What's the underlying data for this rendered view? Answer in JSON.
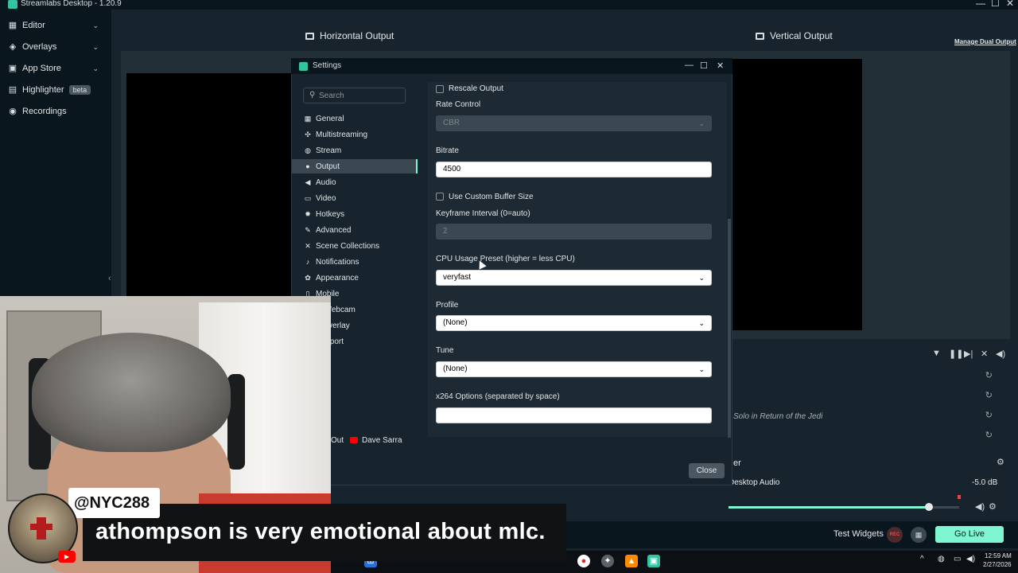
{
  "app": {
    "title": "Streamlabs Desktop - 1.20.9",
    "window_controls": [
      "—",
      "☐",
      "✕"
    ]
  },
  "left_nav": [
    {
      "label": "Editor",
      "icon": "editor-icon"
    },
    {
      "label": "Overlays",
      "icon": "overlays-icon"
    },
    {
      "label": "App Store",
      "icon": "app-store-icon"
    },
    {
      "label": "Highlighter",
      "icon": "highlighter-icon",
      "badge": "beta"
    },
    {
      "label": "Recordings",
      "icon": "recordings-icon"
    }
  ],
  "studio": {
    "horizontal_output": "Horizontal Output",
    "vertical_output": "Vertical Output",
    "manage_dual_output": "Manage Dual Output",
    "scene_source_label": "Solo in Return of the Jedi"
  },
  "mixer": {
    "title": "er",
    "source": "Desktop Audio",
    "level": "-5.0 dB",
    "volume_fraction": 0.87
  },
  "footer": {
    "test_widgets": "Test Widgets",
    "rec": "REC",
    "go_live": "Go Live"
  },
  "taskbar": {
    "time": "12:59 AM",
    "date": "2/27/2026"
  },
  "settings": {
    "title": "Settings",
    "search_placeholder": "Search",
    "categories": [
      {
        "label": "General",
        "icon": "grid-icon"
      },
      {
        "label": "Multistreaming",
        "icon": "multistream-icon"
      },
      {
        "label": "Stream",
        "icon": "globe-icon"
      },
      {
        "label": "Output",
        "icon": "output-icon",
        "active": true
      },
      {
        "label": "Audio",
        "icon": "speaker-icon"
      },
      {
        "label": "Video",
        "icon": "video-icon"
      },
      {
        "label": "Hotkeys",
        "icon": "keyboard-icon"
      },
      {
        "label": "Advanced",
        "icon": "wrench-icon"
      },
      {
        "label": "Scene Collections",
        "icon": "scenes-icon"
      },
      {
        "label": "Notifications",
        "icon": "bell-icon"
      },
      {
        "label": "Appearance",
        "icon": "palette-icon"
      },
      {
        "label": "Mobile",
        "icon": "mobile-icon"
      },
      {
        "label": "al Webcam",
        "icon": ""
      },
      {
        "label": "e Overlay",
        "icon": ""
      },
      {
        "label": "Support",
        "icon": ""
      }
    ],
    "account": {
      "service_label": "Out",
      "user": "Dave Sarra"
    },
    "form": {
      "rescale_output": "Rescale Output",
      "rate_control_label": "Rate Control",
      "rate_control_value": "CBR",
      "bitrate_label": "Bitrate",
      "bitrate_value": "4500",
      "custom_buffer_label": "Use Custom Buffer Size",
      "keyframe_label": "Keyframe Interval (0=auto)",
      "keyframe_value": "2",
      "cpu_preset_label": "CPU Usage Preset (higher = less CPU)",
      "cpu_preset_value": "veryfast",
      "profile_label": "Profile",
      "profile_value": "(None)",
      "tune_label": "Tune",
      "tune_value": "(None)",
      "x264_label": "x264 Options (separated by space)",
      "x264_value": ""
    },
    "close_label": "Close"
  },
  "chat": {
    "username": "@NYC288",
    "message": "athompson is very emotional about mlc."
  },
  "colors": {
    "accent": "#80f5d2",
    "panel": "#17242d",
    "nav": "#09161d"
  }
}
